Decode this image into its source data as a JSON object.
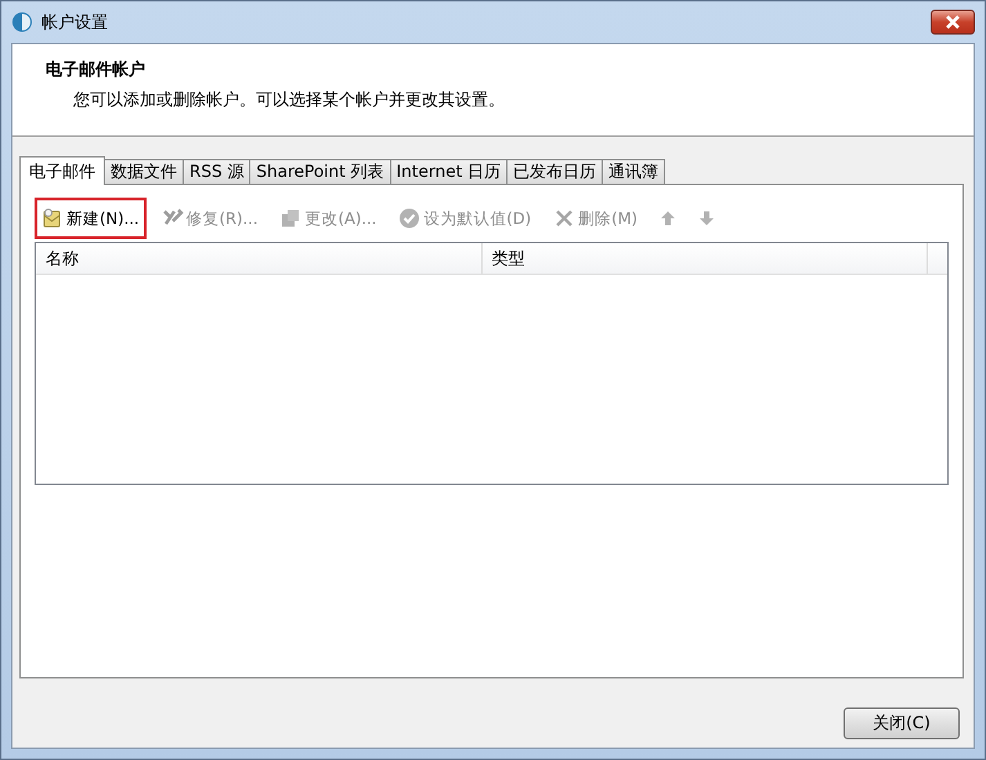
{
  "window": {
    "title": "帐户设置"
  },
  "header": {
    "title": "电子邮件帐户",
    "description": "您可以添加或删除帐户。可以选择某个帐户并更改其设置。"
  },
  "tabs": [
    {
      "label": "电子邮件",
      "selected": true
    },
    {
      "label": "数据文件",
      "selected": false
    },
    {
      "label": "RSS 源",
      "selected": false
    },
    {
      "label": "SharePoint 列表",
      "selected": false
    },
    {
      "label": "Internet 日历",
      "selected": false
    },
    {
      "label": "已发布日历",
      "selected": false
    },
    {
      "label": "通讯簿",
      "selected": false
    }
  ],
  "toolbar": [
    {
      "kind": "new",
      "label": "新建(N)...",
      "disabled": false,
      "highlighted": true
    },
    {
      "kind": "repair",
      "label": "修复(R)...",
      "disabled": true,
      "highlighted": false
    },
    {
      "kind": "change",
      "label": "更改(A)...",
      "disabled": true,
      "highlighted": false
    },
    {
      "kind": "default",
      "label": "设为默认值(D)",
      "disabled": true,
      "highlighted": false
    },
    {
      "kind": "delete",
      "label": "删除(M)",
      "disabled": true,
      "highlighted": false
    },
    {
      "kind": "up",
      "disabled": true,
      "highlighted": false
    },
    {
      "kind": "down",
      "disabled": true,
      "highlighted": false
    }
  ],
  "table": {
    "columns": [
      "名称",
      "类型"
    ]
  },
  "buttons": [
    {
      "label": "关闭(C)"
    }
  ]
}
